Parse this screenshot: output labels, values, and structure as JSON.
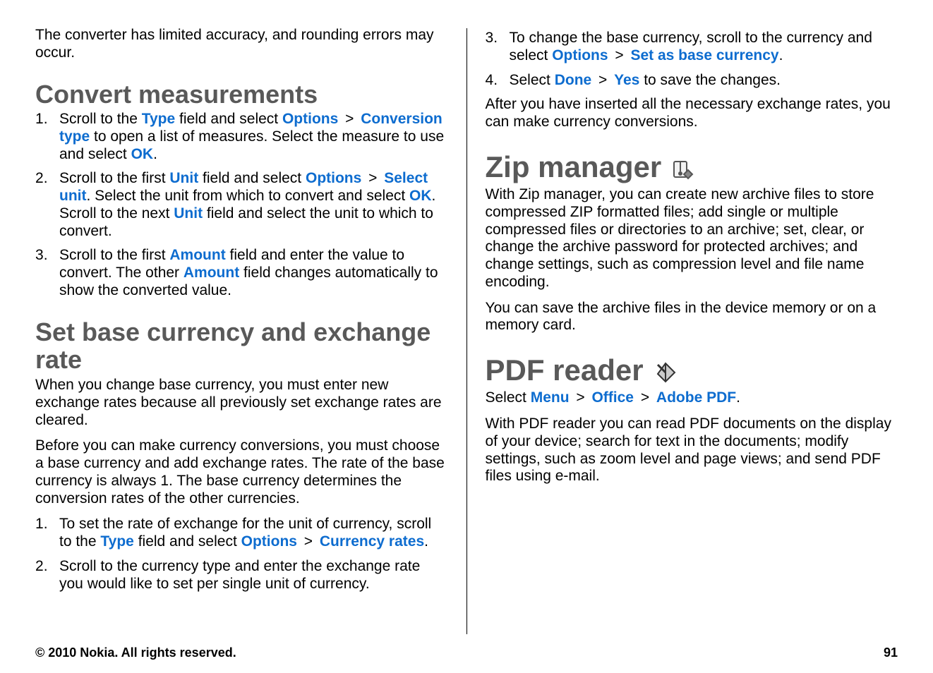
{
  "col1": {
    "intro": "The converter has limited accuracy, and rounding errors may occur.",
    "h2_convert": "Convert measurements",
    "steps_a": {
      "s1_a": "Scroll to the ",
      "s1_type": "Type",
      "s1_b": " field and select ",
      "s1_options": "Options",
      "s1_conv": "Conversion type",
      "s1_c": " to open a list of measures. Select the measure to use and select ",
      "s1_ok": "OK",
      "s2_a": "Scroll to the first ",
      "s2_unit": "Unit",
      "s2_b": " field and select ",
      "s2_options": "Options",
      "s2_select": "Select unit",
      "s2_c": ". Select the unit from which to convert and select ",
      "s2_ok": "OK",
      "s2_d": ". Scroll to the next ",
      "s2_unit2": "Unit",
      "s2_e": " field and select the unit to which to convert.",
      "s3_a": "Scroll to the first ",
      "s3_amount": "Amount",
      "s3_b": " field and enter the value to convert. The other ",
      "s3_amount2": "Amount",
      "s3_c": " field changes automatically to show the converted value."
    },
    "h2_rate": "Set base currency and exchange rate",
    "rate_p1": "When you change base currency, you must enter new exchange rates because all previously set exchange rates are cleared.",
    "rate_p2": "Before you can make currency conversions, you must choose a base currency and add exchange rates. The rate of the base currency is always 1. The base currency determines the conversion rates of the other currencies.",
    "steps_b": {
      "s1_a": "To set the rate of exchange for the unit of currency, scroll to the ",
      "s1_type": "Type",
      "s1_b": " field and select ",
      "s1_options": "Options",
      "s1_rates": "Currency rates",
      "s2": "Scroll to the currency type and enter the exchange rate you would like to set per single unit of currency."
    }
  },
  "col2": {
    "steps_c": {
      "s3_a": "To change the base currency, scroll to the currency and select ",
      "s3_options": "Options",
      "s3_set": "Set as base currency",
      "s4_a": "Select ",
      "s4_done": "Done",
      "s4_yes": "Yes",
      "s4_b": " to save the changes."
    },
    "after": "After you have inserted all the necessary exchange rates, you can make currency conversions.",
    "h1_zip": "Zip manager",
    "zip_p1": "With Zip manager, you can create new archive files to store compressed ZIP formatted files; add single or multiple compressed files or directories to an archive; set, clear, or change the archive password for protected archives; and change settings, such as compression level and file name encoding.",
    "zip_p2": "You can save the archive files in the device memory or on a memory card.",
    "h1_pdf": "PDF reader",
    "pdf_select_a": "Select ",
    "pdf_menu": "Menu",
    "pdf_office": "Office",
    "pdf_adobe": "Adobe PDF",
    "pdf_p1": "With PDF reader you can read PDF documents on the display of your device; search for text in the documents; modify settings, such as zoom level and page views; and send PDF files using e-mail."
  },
  "footer": {
    "copyright": "© 2010 Nokia. All rights reserved.",
    "page": "91"
  }
}
